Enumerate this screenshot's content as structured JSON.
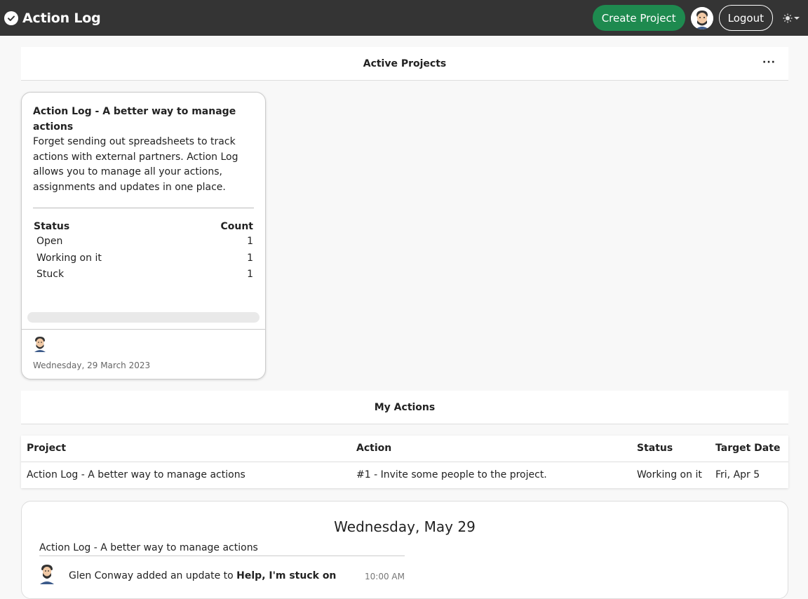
{
  "navbar": {
    "title": "Action Log",
    "create_label": "Create Project",
    "logout_label": "Logout",
    "theme_icon": "sun-icon"
  },
  "active_projects": {
    "title": "Active Projects",
    "more_label": "···",
    "cards": [
      {
        "title": "Action Log - A better way to manage actions",
        "description": "Forget sending out spreadsheets to track actions with external partners. Action Log allows you to manage all your actions, assignments and updates in one place.",
        "status_header": "Status",
        "count_header": "Count",
        "statuses": [
          {
            "label": "Open",
            "count": "1"
          },
          {
            "label": "Working on it",
            "count": "1"
          },
          {
            "label": "Stuck",
            "count": "1"
          }
        ],
        "progress": 0,
        "date": "Wednesday, 29 March 2023"
      }
    ]
  },
  "my_actions": {
    "title": "My Actions",
    "columns": [
      "Project",
      "Action",
      "Status",
      "Target Date"
    ],
    "rows": [
      [
        "Action Log - A better way to manage actions",
        "#1 - Invite some people to the project.",
        "Working on it",
        "Fri, Apr 5"
      ]
    ]
  },
  "timeline": {
    "date": "Wednesday, May 29",
    "project": "Action Log - A better way to manage actions",
    "item": {
      "text_prefix": "Glen Conway added an update to ",
      "text_bold": "Help, I'm stuck on",
      "time": "10:00 AM"
    }
  },
  "colors": {
    "navbar": "#343434",
    "accent": "#1e8a4f"
  }
}
